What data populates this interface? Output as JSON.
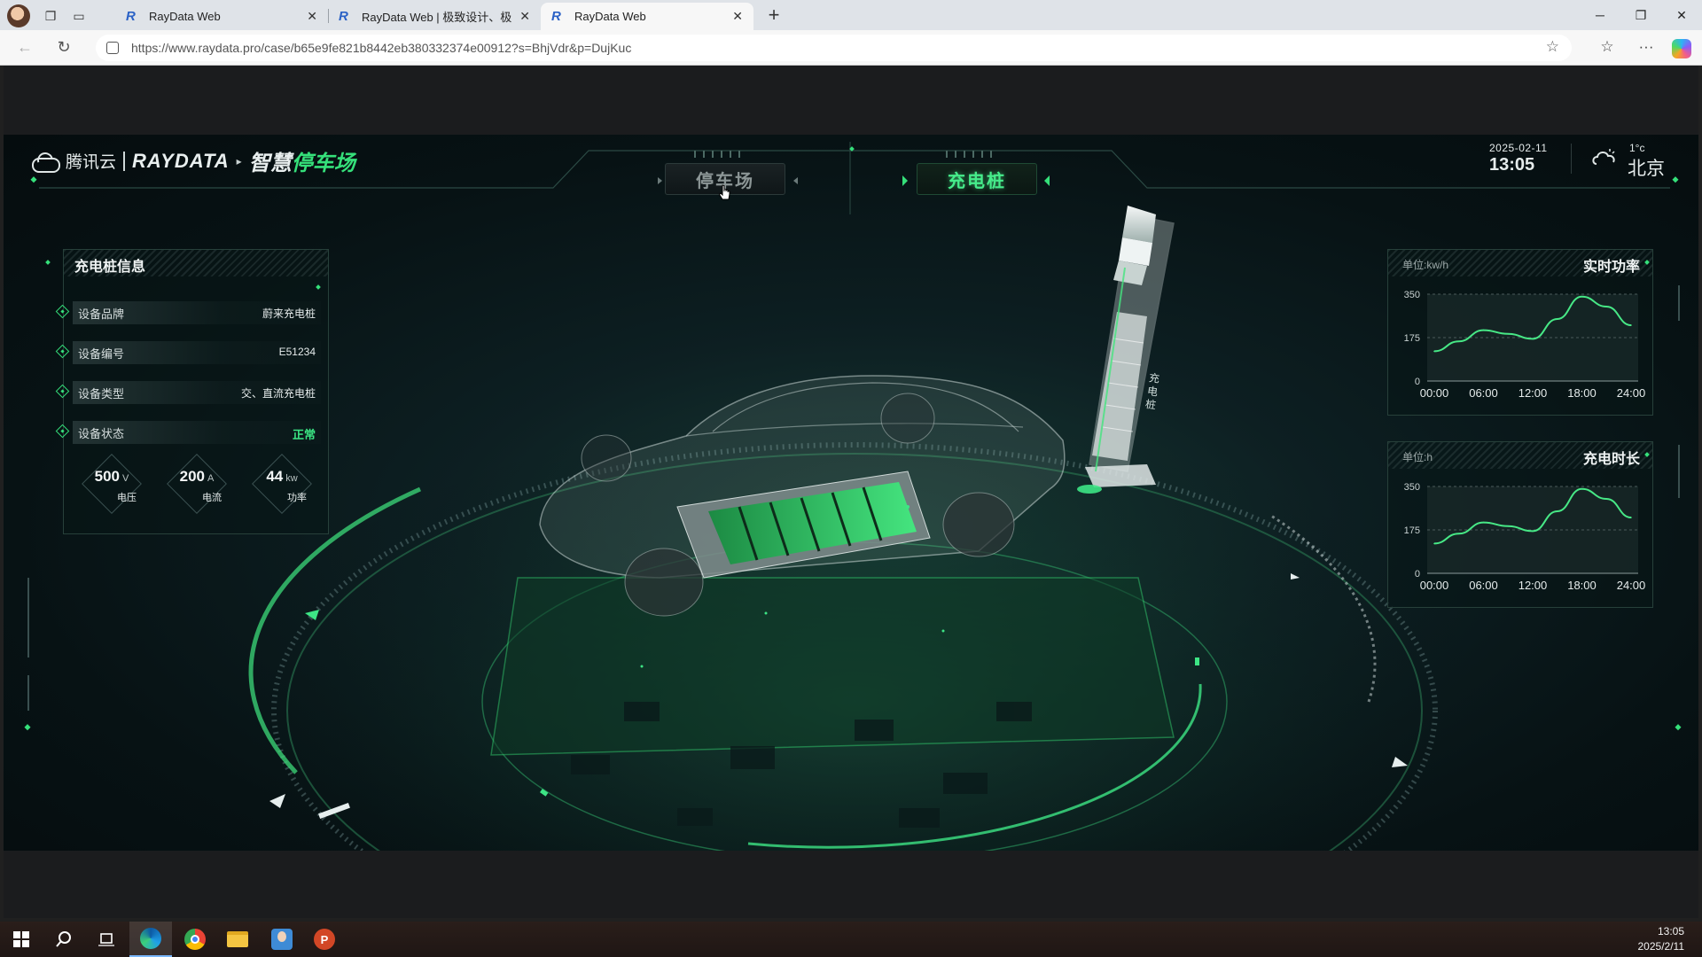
{
  "browser": {
    "tabs": [
      {
        "title": "RayData Web",
        "active": false
      },
      {
        "title": "RayData Web | 极致设计、极简流",
        "active": false
      },
      {
        "title": "RayData Web",
        "active": true
      }
    ],
    "url_domain": "https://www.raydata.pro",
    "url_path": "/case/b65e9fe821b8442eb380332374e00912?s=BhjVdr&p=DujKuc"
  },
  "header": {
    "brand_cn": "腾讯云",
    "brand_ray": "RAYDATA",
    "app_title_a": "智慧",
    "app_title_b": "停车场",
    "mode_tabs": [
      {
        "label": "停车场",
        "active": false
      },
      {
        "label": "充电桩",
        "active": true
      }
    ],
    "date": "2025-02-11",
    "time": "13:05",
    "temperature": "1°c",
    "city": "北京"
  },
  "info_panel": {
    "title": "充电桩信息",
    "rows": [
      {
        "label": "设备品牌",
        "value": "蔚来充电桩"
      },
      {
        "label": "设备编号",
        "value": "E51234"
      },
      {
        "label": "设备类型",
        "value": "交、直流充电桩"
      },
      {
        "label": "设备状态",
        "value": "正常"
      }
    ],
    "metrics": [
      {
        "value": "500",
        "unit": "V",
        "name": "电压"
      },
      {
        "value": "200",
        "unit": "A",
        "name": "电流"
      },
      {
        "value": "44",
        "unit": "kw",
        "name": "功率"
      }
    ]
  },
  "pile_label": "充电桩",
  "chart_data": [
    {
      "type": "line",
      "title": "实时功率",
      "unit_label": "单位:kw/h",
      "x": [
        "00:00",
        "06:00",
        "12:00",
        "18:00",
        "24:00"
      ],
      "yticks": [
        0,
        175,
        350
      ],
      "ylim": [
        0,
        350
      ],
      "series": [
        {
          "x_hours": [
            0,
            3,
            6,
            9,
            12,
            15,
            18,
            21,
            24
          ],
          "values": [
            120,
            160,
            205,
            190,
            170,
            250,
            340,
            300,
            225
          ]
        }
      ],
      "color": "#47e886"
    },
    {
      "type": "line",
      "title": "充电时长",
      "unit_label": "单位:h",
      "x": [
        "00:00",
        "06:00",
        "12:00",
        "18:00",
        "24:00"
      ],
      "yticks": [
        0,
        175,
        350
      ],
      "ylim": [
        0,
        350
      ],
      "series": [
        {
          "x_hours": [
            0,
            3,
            6,
            9,
            12,
            15,
            18,
            21,
            24
          ],
          "values": [
            120,
            160,
            205,
            190,
            170,
            250,
            340,
            300,
            225
          ]
        }
      ],
      "color": "#47e886"
    }
  ],
  "taskbar": {
    "time": "13:05",
    "date": "2025/2/11"
  },
  "colors": {
    "accent_green": "#35e07a",
    "panel_border": "#27403a",
    "background": "#071214"
  }
}
